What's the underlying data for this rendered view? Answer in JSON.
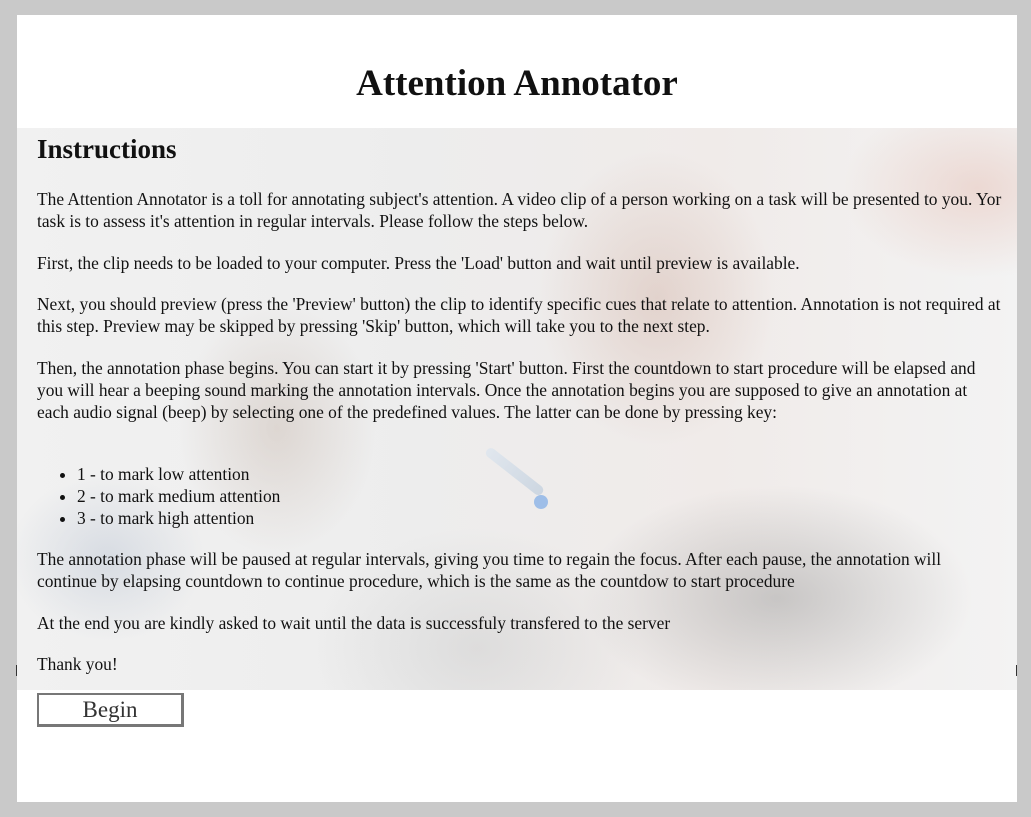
{
  "title": "Attention Annotator",
  "instructions": {
    "heading": "Instructions",
    "paragraphs": [
      "The Attention Annotator is a toll for annotating subject's attention. A video clip of a person working on a task will be presented to you. Yor task is to assess it's attention in regular intervals. Please follow the steps below.",
      "First, the clip needs to be loaded to your computer. Press the 'Load' button and wait until preview is available.",
      "Next, you should preview (press the 'Preview' button) the clip to identify specific cues that relate to attention. Annotation is not required at this step. Preview may be skipped by pressing 'Skip' button, which will take you to the next step.",
      "Then, the annotation phase begins. You can start it by pressing 'Start' button. First the countdown to start procedure will be elapsed and you will hear a beeping sound marking the annotation intervals. Once the annotation begins you are supposed to give an annotation at each audio signal (beep) by selecting one of the predefined values. The latter can be done by pressing key:",
      "The annotation phase will be paused at regular intervals, giving you time to regain the focus. After each pause, the annotation will continue by elapsing countdown to continue procedure, which is the same as the countdow to start procedure",
      "At the end you are kindly asked to wait until the data is successfuly transfered to the server",
      "Thank you!"
    ],
    "keys": [
      "1 - to mark low attention",
      "2 - to mark medium attention",
      "3 - to mark high attention"
    ]
  },
  "begin_button": "Begin"
}
